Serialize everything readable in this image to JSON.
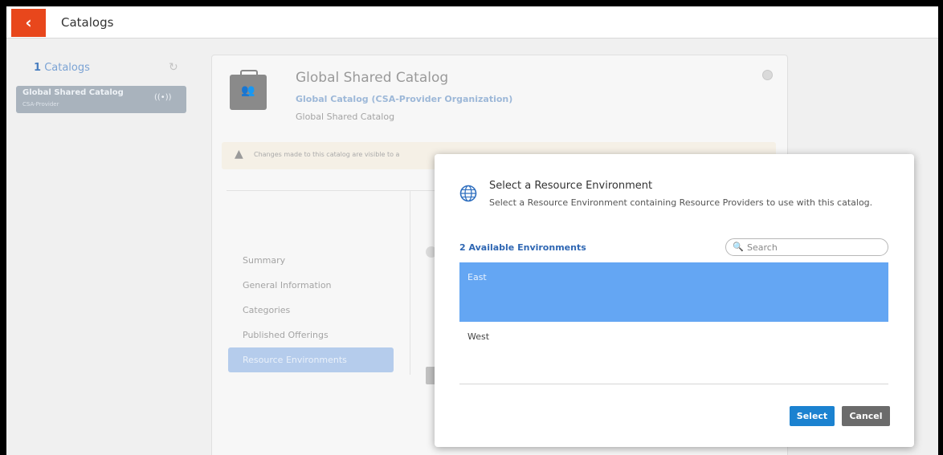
{
  "topbar": {
    "back_symbol": "‹",
    "title": "Catalogs"
  },
  "catalog_list": {
    "count": "1",
    "count_label": "Catalogs",
    "items": [
      {
        "name": "Global Shared Catalog",
        "sub": "CSA-Provider"
      }
    ]
  },
  "catalog": {
    "title": "Global Shared Catalog",
    "link": "Global Catalog (CSA-Provider Organization)",
    "subtitle": "Global Shared Catalog",
    "warning": "Changes made to this catalog are visible to a",
    "nav": [
      {
        "label": "Summary"
      },
      {
        "label": "General Information"
      },
      {
        "label": "Categories"
      },
      {
        "label": "Published Offerings"
      },
      {
        "label": "Resource Environments"
      }
    ]
  },
  "modal": {
    "title": "Select a Resource Environment",
    "description": "Select a Resource Environment containing Resource Providers to use with this catalog.",
    "count_label": "2 Available Environments",
    "search_placeholder": "Search",
    "environments": [
      {
        "name": "East",
        "selected": true
      },
      {
        "name": "West",
        "selected": false
      }
    ],
    "select_label": "Select",
    "cancel_label": "Cancel"
  },
  "colors": {
    "accent_orange": "#e8471c",
    "primary_blue": "#1b82d0",
    "selection_blue": "#64a6f3"
  }
}
